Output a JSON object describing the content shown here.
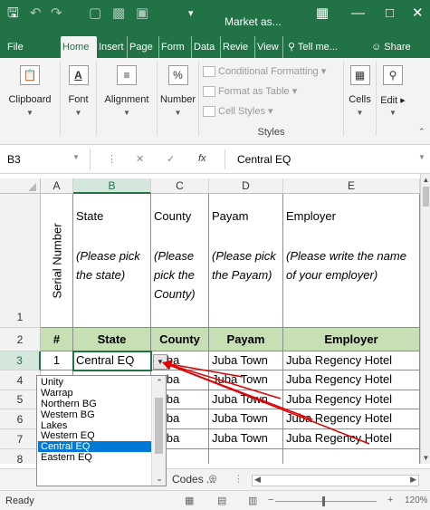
{
  "titlebar": {
    "title": "Market as...",
    "save_icon": "save-icon",
    "undo_icon": "undo-icon",
    "redo_icon": "redo-icon"
  },
  "ribbon_tabs": [
    "File",
    "Home",
    "Insert",
    "Page",
    "Form",
    "Data",
    "Revie",
    "View"
  ],
  "tell_me": "Tell me...",
  "share": "Share",
  "ribbon": {
    "clipboard": "Clipboard",
    "font": "Font",
    "alignment": "Alignment",
    "number": "Number",
    "conditional_formatting": "Conditional Formatting",
    "format_as_table": "Format as Table",
    "cell_styles": "Cell Styles",
    "styles": "Styles",
    "cells": "Cells",
    "editing": "Edit"
  },
  "formula_bar": {
    "name_box": "B3",
    "fx": "fx",
    "value": "Central EQ"
  },
  "columns": [
    "A",
    "B",
    "C",
    "D",
    "E"
  ],
  "rows": [
    "1",
    "2",
    "3",
    "4",
    "5",
    "6",
    "7",
    "8"
  ],
  "header_row1": {
    "serial": "Serial Number",
    "state": "State",
    "state_hint": "(Please pick the state)",
    "county": "County",
    "county_hint": "(Please pick the County)",
    "payam": "Payam",
    "payam_hint": "(Please pick the Payam)",
    "employer": "Employer",
    "employer_hint": "(Please write the name of your employer)"
  },
  "header_row2": [
    "#",
    "State",
    "County",
    "Payam",
    "Employer"
  ],
  "data_rows": [
    {
      "a": "1",
      "b": "Central EQ",
      "c": "Juba",
      "d": "Juba Town",
      "e": "Juba Regency Hotel"
    },
    {
      "a": "",
      "b": "",
      "c": "Juba",
      "d": "Juba Town",
      "e": "Juba Regency Hotel"
    },
    {
      "a": "",
      "b": "",
      "c": "Juba",
      "d": "Juba Town",
      "e": "Juba Regency Hotel"
    },
    {
      "a": "",
      "b": "",
      "c": "Juba",
      "d": "Juba Town",
      "e": "Juba Regency Hotel"
    },
    {
      "a": "",
      "b": "",
      "c": "Juba",
      "d": "Juba Town",
      "e": "Juba Regency Hotel"
    }
  ],
  "dropdown": {
    "items": [
      "Unity",
      "Warrap",
      "Northern BG",
      "Western BG",
      "Lakes",
      "Western EQ",
      "Central EQ",
      "Eastern EQ"
    ],
    "selected": "Central EQ"
  },
  "sheet": {
    "tab": "Codes ...",
    "add_icon": "plus-circle-icon"
  },
  "status": {
    "ready": "Ready",
    "zoom": "120%"
  },
  "colors": {
    "excel_green": "#217346",
    "header_fill": "#c6e0b4",
    "selection_blue": "#0078d7",
    "arrow_red": "#e00000"
  }
}
